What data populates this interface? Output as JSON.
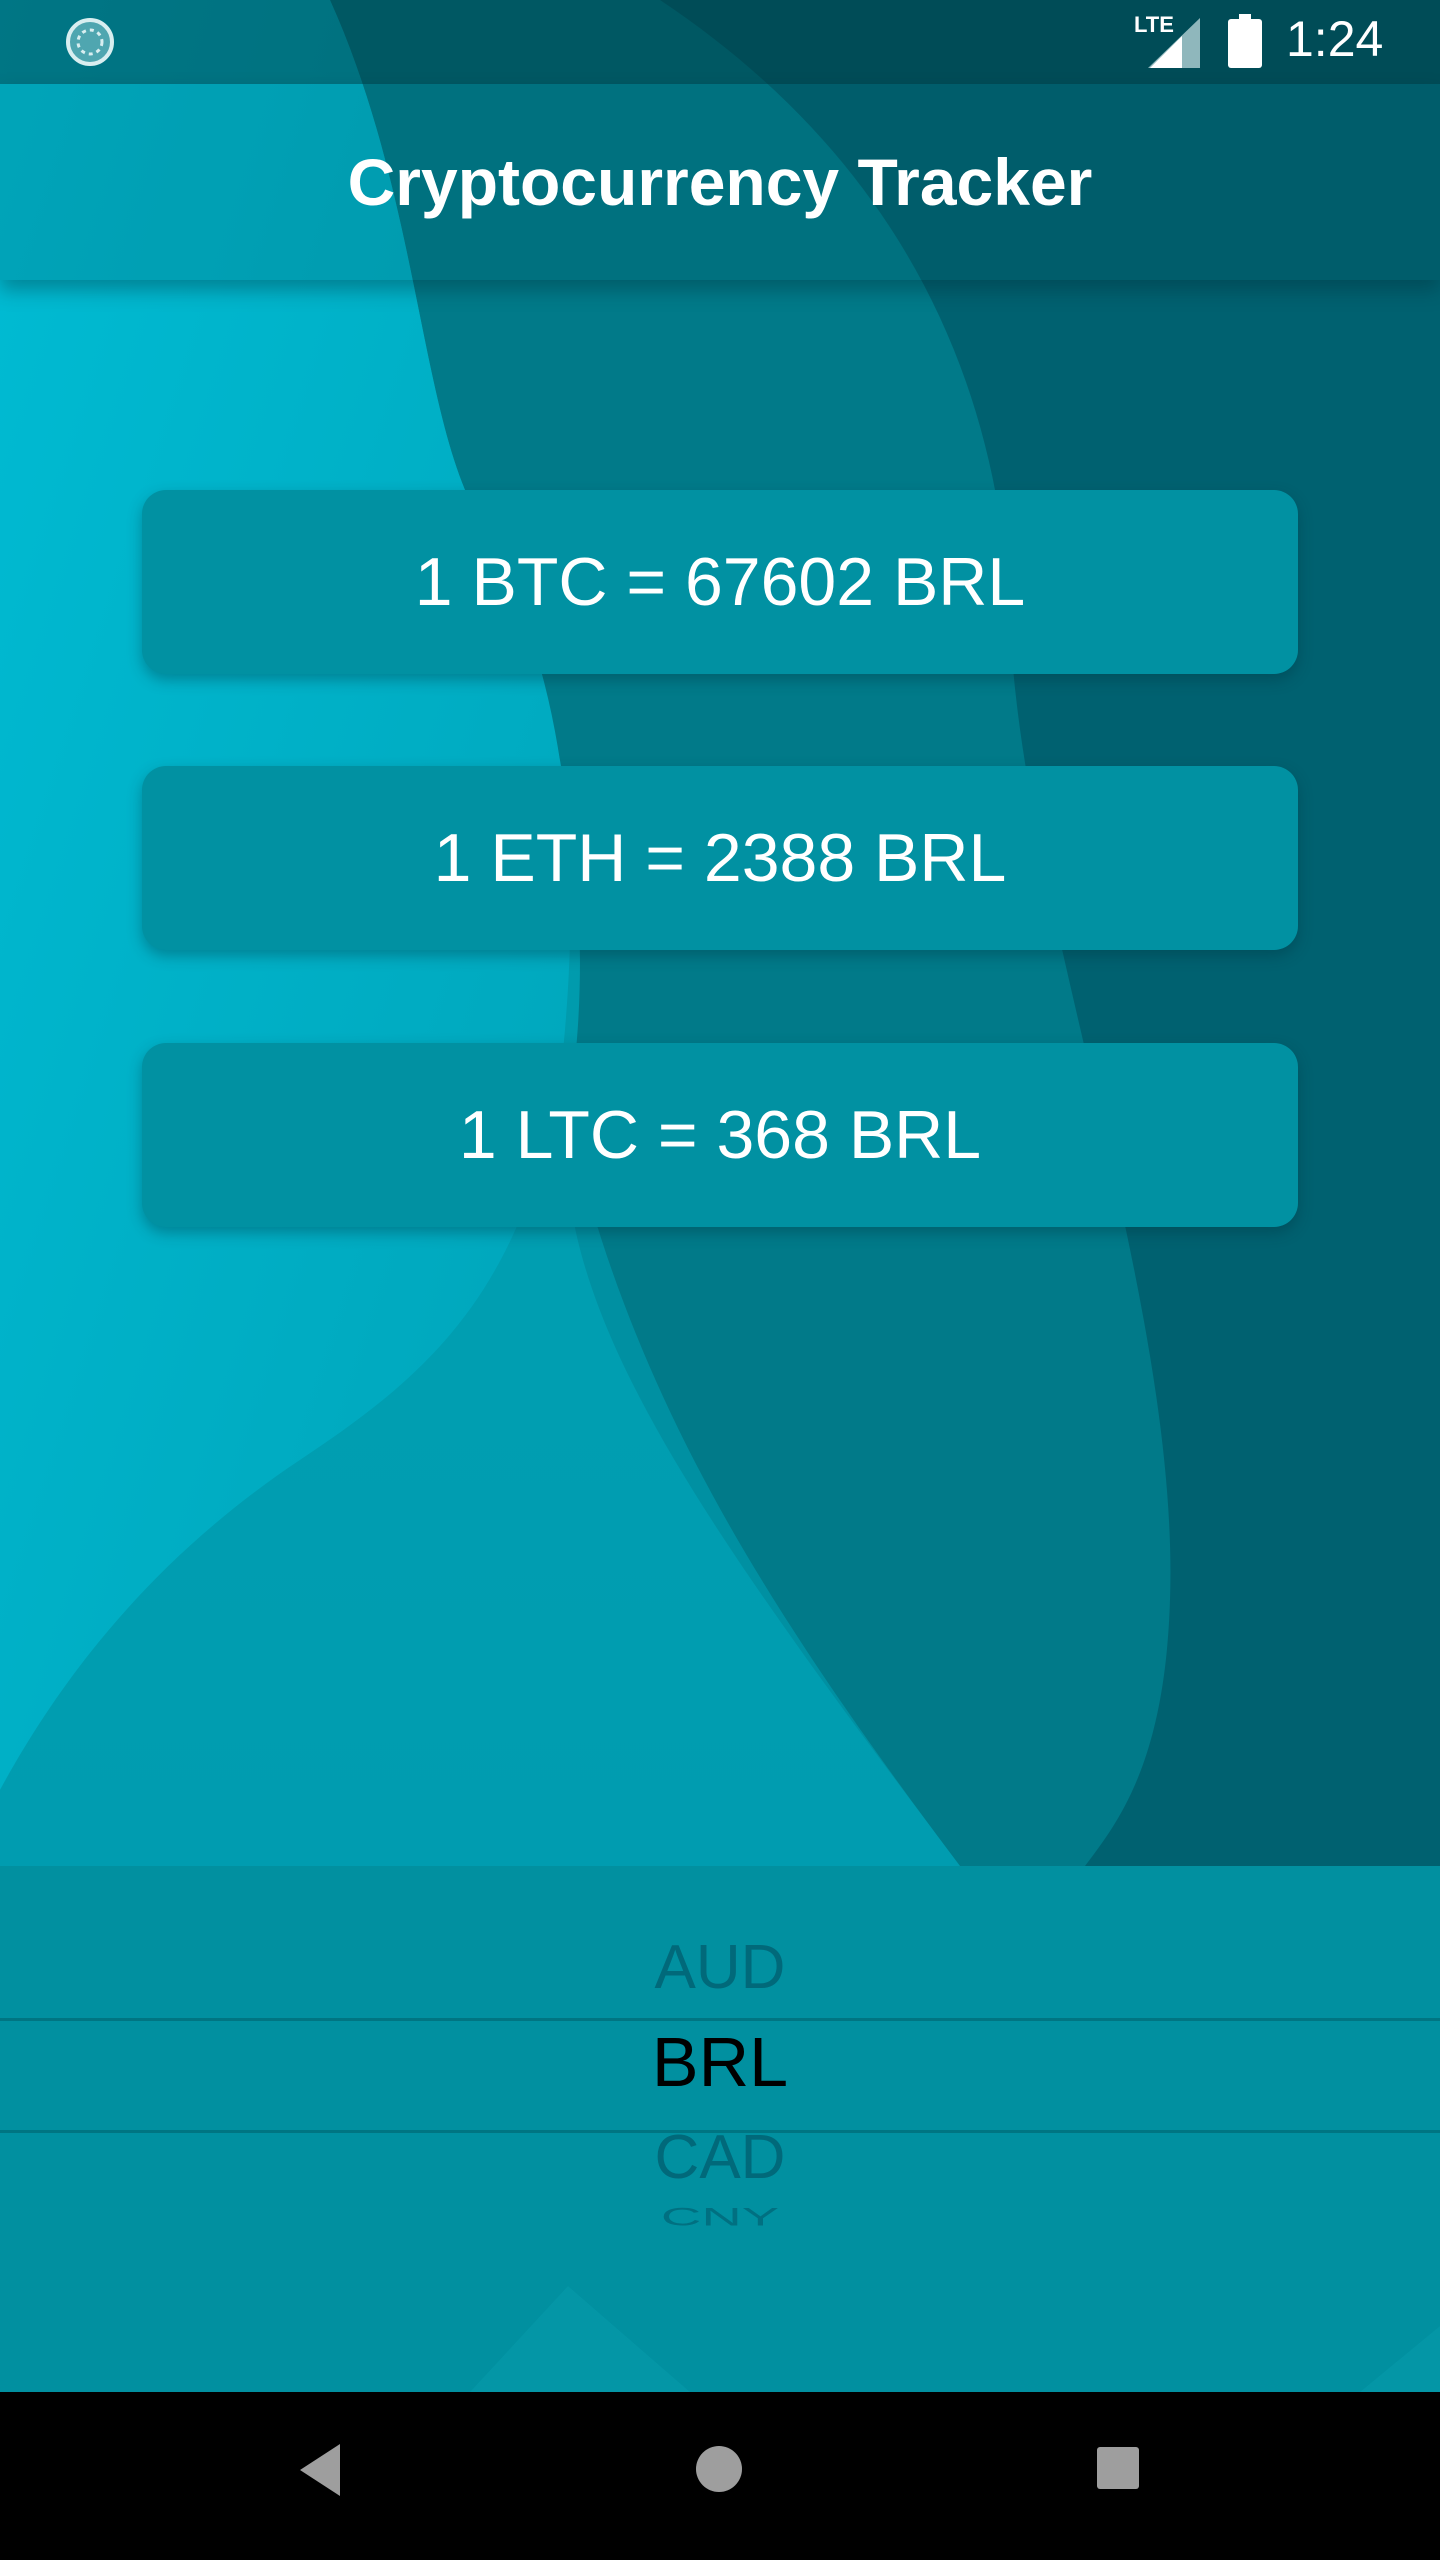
{
  "status_bar": {
    "network": "LTE",
    "time": "1:24",
    "left_icon": "loading-circle-icon",
    "signal_icon": "signal-icon",
    "battery_icon": "battery-icon"
  },
  "app_bar": {
    "title": "Cryptocurrency Tracker"
  },
  "rates": {
    "btc": "1 BTC = 67602 BRL",
    "eth": "1 ETH = 2388 BRL",
    "ltc": "1 LTC = 368 BRL"
  },
  "currency_picker": {
    "options": [
      "AUD",
      "BRL",
      "CAD",
      "CNY"
    ],
    "selected": "BRL"
  },
  "nav_bar": {
    "back_icon": "back-triangle-icon",
    "home_icon": "home-circle-icon",
    "recents_icon": "recents-square-icon"
  },
  "colors": {
    "background_dark": "#006a78",
    "background_light": "#00b4cc",
    "card": "#0191a2",
    "picker_panel": "#0190a0",
    "picker_selected_text": "#000000",
    "picker_other_text": "#01697a"
  }
}
